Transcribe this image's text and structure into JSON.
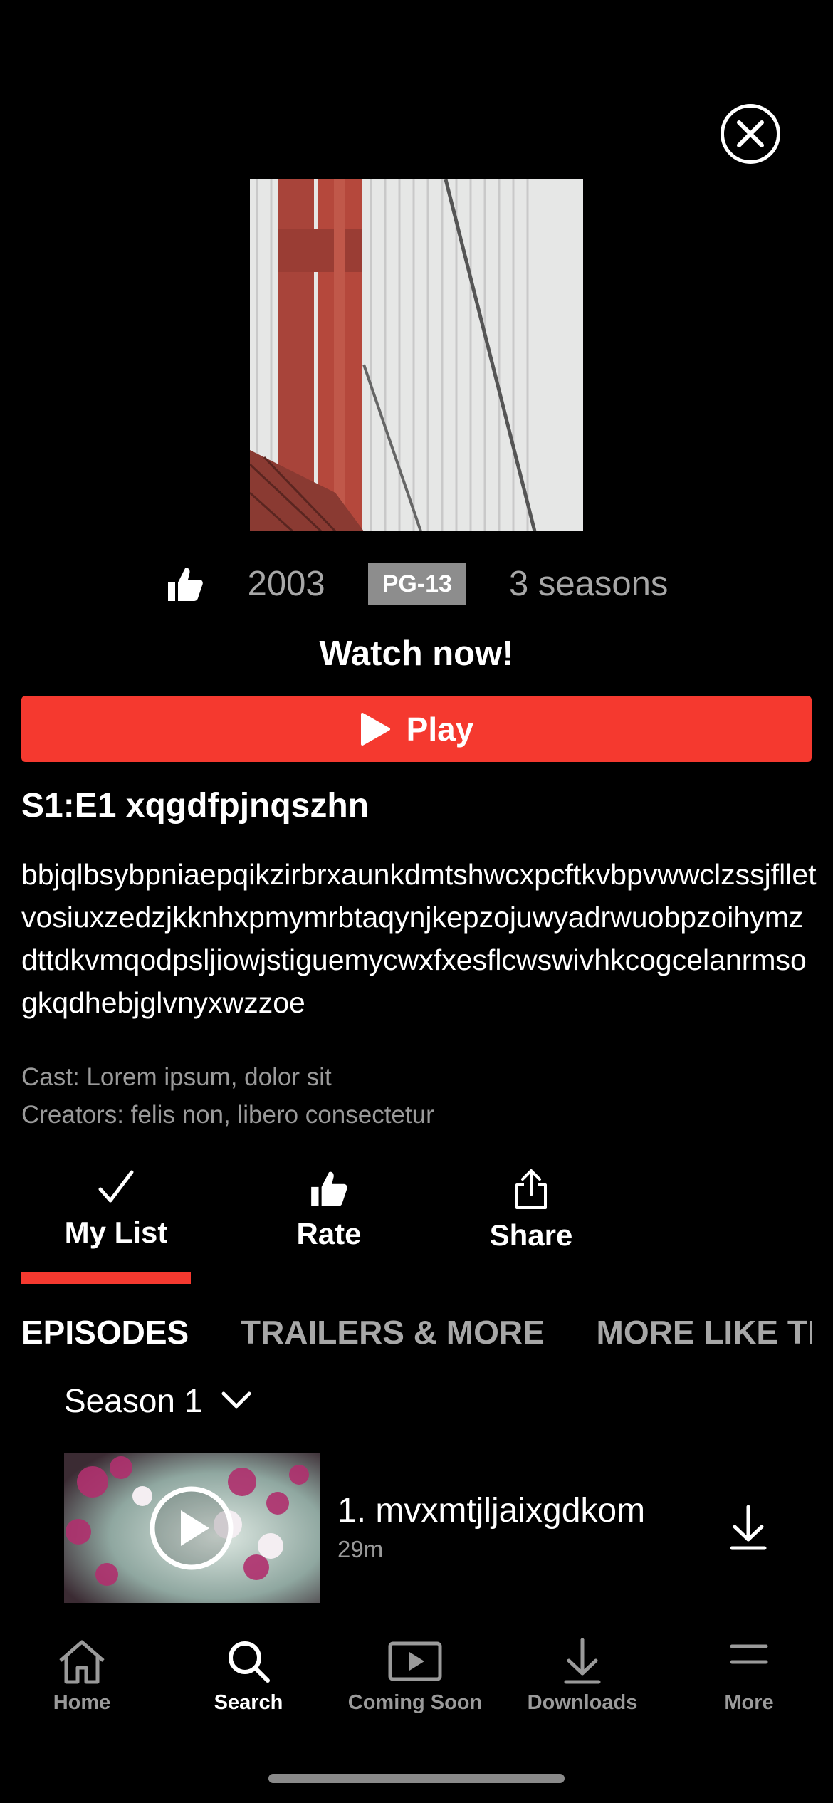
{
  "meta": {
    "year": "2003",
    "rating": "PG-13",
    "seasons": "3 seasons"
  },
  "watch_now": "Watch now!",
  "play_label": "Play",
  "episode_heading": "S1:E1 xqgdfpjnqszhn",
  "description": "bbjqlbsybpniaepqikzirbrxaunkdmtshwcxpcftkvbpvwwclzssjflletvosiuxzedzjkknhxpmymrbtaqynjkepzojuwyadrwuobpzoihymzdttdkvmqodpsljiowjstiguemycwxfxesflcwswivhkcogcelanrmsogkqdhebjglvnyxwzzoe",
  "credits": {
    "cast": "Cast: Lorem ipsum, dolor sit",
    "creators": "Creators: felis non, libero consectetur"
  },
  "actions": {
    "my_list": "My List",
    "rate": "Rate",
    "share": "Share"
  },
  "tabs": {
    "episodes": "EPISODES",
    "trailers": "TRAILERS & MORE",
    "more_like": "MORE LIKE THIS"
  },
  "season": "Season 1",
  "episode": {
    "name": "1. mvxmtjljaixgdkom",
    "duration": "29m"
  },
  "tabbar": {
    "home": "Home",
    "search": "Search",
    "coming_soon": "Coming Soon",
    "downloads": "Downloads",
    "more": "More"
  },
  "colors": {
    "accent": "#f5392f",
    "muted_text": "#a7a7a7",
    "rating_badge": "#8d8d8d"
  },
  "icons": [
    "close-icon",
    "thumbs-up-icon",
    "play-icon",
    "check-icon",
    "share-icon",
    "chevron-down-icon",
    "download-icon",
    "home-icon",
    "search-icon",
    "coming-soon-icon",
    "downloads-icon",
    "more-icon"
  ]
}
